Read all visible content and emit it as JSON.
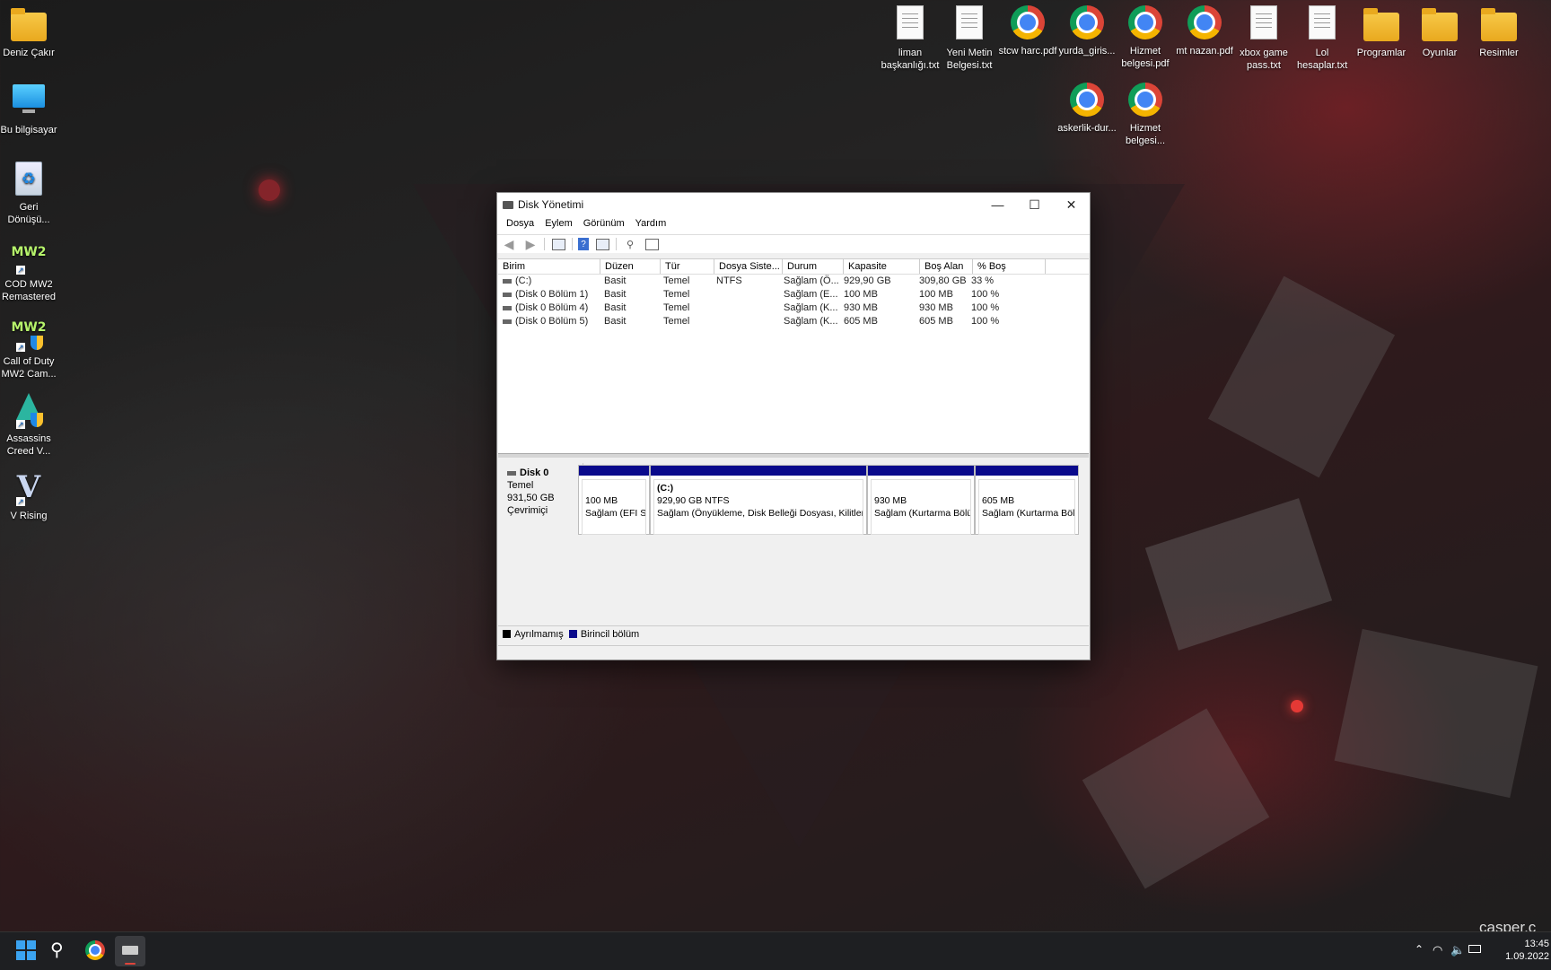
{
  "desktop": {
    "left_icons": [
      {
        "label": "Deniz Çakır",
        "icon": "user-folder-icon"
      },
      {
        "label": "Bu bilgisayar",
        "icon": "monitor-icon"
      },
      {
        "label": "Geri Dönüşü...",
        "icon": "recycle-bin-icon"
      },
      {
        "label": "COD MW2 Remastered",
        "icon": "mw2-icon"
      },
      {
        "label": "Call of Duty MW2 Cam...",
        "icon": "mw2-shield-icon"
      },
      {
        "label": "Assassins Creed V...",
        "icon": "assassins-creed-icon"
      },
      {
        "label": "V Rising",
        "icon": "v-rising-icon"
      }
    ],
    "top_icons": [
      {
        "label": "liman başkanlığı.txt",
        "icon": "text-file-icon"
      },
      {
        "label": "Yeni Metin Belgesi.txt",
        "icon": "text-file-icon"
      },
      {
        "label": "stcw harc.pdf",
        "icon": "chrome-icon"
      },
      {
        "label": "yurda_giris...",
        "icon": "chrome-icon"
      },
      {
        "label": "Hizmet belgesi.pdf",
        "icon": "chrome-icon"
      },
      {
        "label": "mt nazan.pdf",
        "icon": "chrome-icon"
      },
      {
        "label": "xbox game pass.txt",
        "icon": "text-file-icon"
      },
      {
        "label": "Lol hesaplar.txt",
        "icon": "text-file-icon"
      },
      {
        "label": "Programlar",
        "icon": "folder-icon"
      },
      {
        "label": "Oyunlar",
        "icon": "folder-icon"
      },
      {
        "label": "Resimler",
        "icon": "folder-icon"
      }
    ],
    "second_row_icons": [
      {
        "label": "askerlik-dur...",
        "icon": "chrome-icon"
      },
      {
        "label": "Hizmet belgesi...",
        "icon": "chrome-icon"
      }
    ],
    "watermark": "casper.c"
  },
  "window": {
    "title": "Disk Yönetimi",
    "controls": {
      "minimize": "—",
      "maximize": "☐",
      "close": "✕"
    },
    "menu": [
      "Dosya",
      "Eylem",
      "Görünüm",
      "Yardım"
    ],
    "toolbar": [
      "back-arrow-icon",
      "forward-arrow-icon",
      "console-tree-icon",
      "help-icon",
      "properties-icon",
      "rescan-icon",
      "settings-icon"
    ],
    "table": {
      "columns": [
        "Birim",
        "Düzen",
        "Tür",
        "Dosya Siste...",
        "Durum",
        "Kapasite",
        "Boş Alan",
        "% Boş"
      ],
      "rows": [
        [
          "(C:)",
          "Basit",
          "Temel",
          "NTFS",
          "Sağlam (Ö...",
          "929,90 GB",
          "309,80 GB",
          "33 %"
        ],
        [
          "(Disk 0 Bölüm 1)",
          "Basit",
          "Temel",
          "",
          "Sağlam (E...",
          "100 MB",
          "100 MB",
          "100 %"
        ],
        [
          "(Disk 0 Bölüm 4)",
          "Basit",
          "Temel",
          "",
          "Sağlam (K...",
          "930 MB",
          "930 MB",
          "100 %"
        ],
        [
          "(Disk 0 Bölüm 5)",
          "Basit",
          "Temel",
          "",
          "Sağlam (K...",
          "605 MB",
          "605 MB",
          "100 %"
        ]
      ]
    },
    "disk": {
      "name": "Disk 0",
      "type": "Temel",
      "size": "931,50 GB",
      "status": "Çevrimiçi",
      "partitions": [
        {
          "title": "",
          "size": "100 MB",
          "status": "Sağlam (EFI Si"
        },
        {
          "title": "(C:)",
          "size": "929,90 GB NTFS",
          "status": "Sağlam (Önyükleme, Disk Belleği Dosyası, Kilitler"
        },
        {
          "title": "",
          "size": "930 MB",
          "status": "Sağlam (Kurtarma Bölü"
        },
        {
          "title": "",
          "size": "605 MB",
          "status": "Sağlam (Kurtarma Böl"
        }
      ]
    },
    "legend": [
      {
        "label": "Ayrılmamış",
        "color": "#000000"
      },
      {
        "label": "Birincil bölüm",
        "color": "#0a0a8c"
      }
    ]
  },
  "taskbar": {
    "time": "13:45",
    "date": "1.09.2022",
    "apps": [
      "start-icon",
      "search-icon",
      "chrome-icon",
      "disk-management-icon"
    ]
  }
}
